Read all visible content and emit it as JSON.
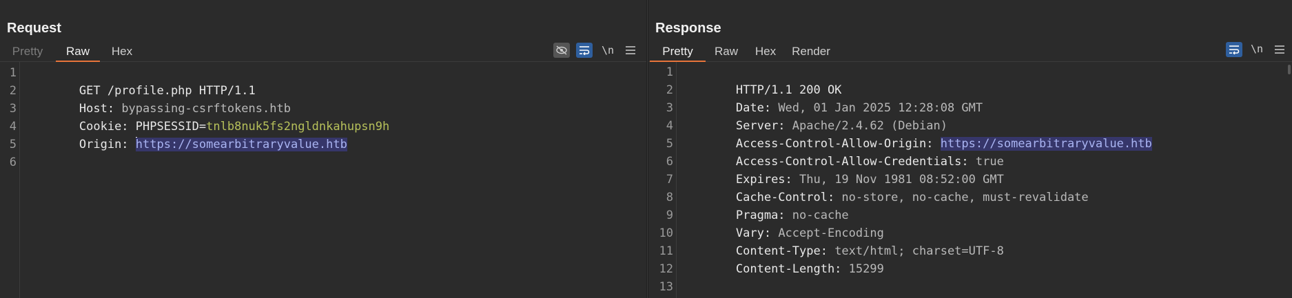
{
  "request": {
    "title": "Request",
    "tabs": [
      {
        "label": "Pretty",
        "state": "disabled"
      },
      {
        "label": "Raw",
        "state": "active"
      },
      {
        "label": "Hex",
        "state": "normal"
      }
    ],
    "tools": {
      "hide_icon": "eye-slash-icon",
      "wrap_icon": "text-wrap-icon",
      "newline_label": "\\n",
      "menu_icon": "hamburger-menu-icon"
    },
    "line_numbers": [
      "1",
      "2",
      "3",
      "4",
      "5",
      "6"
    ],
    "lines": {
      "l1": "GET /profile.php HTTP/1.1",
      "l2_name": "Host:",
      "l2_value": " bypassing-csrftokens.htb",
      "l3_name": "Cookie:",
      "l3_cookie_name": " PHPSESSID=",
      "l3_cookie_value": "tnlb8nuk5fs2ngldnkahupsn9h",
      "l4_name": "Origin: ",
      "l4_value": "https://somearbitraryvalue.htb"
    }
  },
  "response": {
    "title": "Response",
    "tabs": [
      {
        "label": "Pretty",
        "state": "active"
      },
      {
        "label": "Raw",
        "state": "normal"
      },
      {
        "label": "Hex",
        "state": "normal"
      },
      {
        "label": "Render",
        "state": "normal"
      }
    ],
    "tools": {
      "wrap_icon": "text-wrap-icon",
      "newline_label": "\\n",
      "menu_icon": "hamburger-menu-icon"
    },
    "line_numbers": [
      "1",
      "2",
      "3",
      "4",
      "5",
      "6",
      "7",
      "8",
      "9",
      "10",
      "11",
      "12",
      "13"
    ],
    "lines": {
      "l1": "HTTP/1.1 200 OK",
      "l2_name": "Date:",
      "l2_value": " Wed, 01 Jan 2025 12:28:08 GMT",
      "l3_name": "Server:",
      "l3_value": " Apache/2.4.62 (Debian)",
      "l4_name": "Access-Control-Allow-Origin:",
      "l4_value": "https://somearbitraryvalue.htb",
      "l5_name": "Access-Control-Allow-Credentials:",
      "l5_value": " true",
      "l6_name": "Expires:",
      "l6_value": " Thu, 19 Nov 1981 08:52:00 GMT",
      "l7_name": "Cache-Control:",
      "l7_value": " no-store, no-cache, must-revalidate",
      "l8_name": "Pragma:",
      "l8_value": " no-cache",
      "l9_name": "Vary:",
      "l9_value": " Accept-Encoding",
      "l10_name": "Content-Type:",
      "l10_value": " text/html; charset=UTF-8",
      "l11_name": "Content-Length:",
      "l11_value": " 15299"
    }
  },
  "layout_buttons": [
    {
      "icon": "split-columns-icon",
      "active": true
    },
    {
      "icon": "split-rows-icon",
      "active": false
    },
    {
      "icon": "single-panel-icon",
      "active": false
    }
  ],
  "colors": {
    "background": "#2b2b2b",
    "accent_tab": "#e8743b",
    "selection": "#36366a",
    "cookie_value": "#b6c05a",
    "tool_active": "#2f5f9e"
  }
}
